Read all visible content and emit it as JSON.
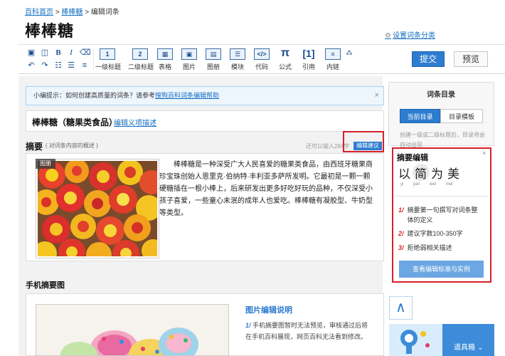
{
  "breadcrumb": {
    "home": "百科首页",
    "sep1": ">",
    "entry": "棒棒糖",
    "sep2": ">",
    "current": "编辑词条"
  },
  "page_title": "棒棒糖",
  "settings_link": "设置词条分类",
  "toolbar": {
    "buttons": [
      {
        "label": "一级标题",
        "icon": "heading-1-icon",
        "glyph": "1"
      },
      {
        "label": "二级标题",
        "icon": "heading-2-icon",
        "glyph": "2"
      },
      {
        "label": "表格",
        "icon": "table-icon",
        "glyph": "▦"
      },
      {
        "label": "图片",
        "icon": "image-icon",
        "glyph": "▣"
      },
      {
        "label": "图册",
        "icon": "album-icon",
        "glyph": "▤"
      },
      {
        "label": "模块",
        "icon": "module-icon",
        "glyph": "☰"
      },
      {
        "label": "代码",
        "icon": "code-icon",
        "glyph": "</>"
      },
      {
        "label": "公式",
        "icon": "formula-icon",
        "glyph": "π"
      },
      {
        "label": "引用",
        "icon": "reference-icon",
        "glyph": "[1]"
      },
      {
        "label": "内链",
        "icon": "link-icon",
        "glyph": "≡"
      }
    ],
    "submit": "提交",
    "preview": "预览"
  },
  "tip": {
    "prefix": "小编提示：如何创建高质量的词条？请参考",
    "link": "搜狗百科词条编辑帮助",
    "close": "×"
  },
  "entry": {
    "title": "棒棒糖（糖果类食品）",
    "edit_link": "编辑义项描述"
  },
  "summary": {
    "label": "摘要",
    "sub": "( 对词条内容的概述 )",
    "count": "还可以输入284字",
    "suggest": "编辑建议",
    "photo_tag": "图册",
    "text": "棒棒糖是一种深受广大人民喜爱的糖果类食品，由西班牙糖果商珍宝珠创始人恩里克·伯纳特·丰利亚多萨所发明。它最初是一颗一颗硬糖插在一根小棒上，后来研发出更多好吃好玩的品种，不仅深受小孩子喜爱，一些童心未泯的成年人也爱吃。棒棒糖有凝胶型、牛奶型等类型。"
  },
  "mobile": {
    "label": "手机摘要图",
    "help_title": "图片编辑说明",
    "help_num": "1/",
    "help_text": "手机摘要图暂时无法预览，审核通过后将在手机百科展现，网页百科无法看到修改。"
  },
  "toc": {
    "title": "词条目录",
    "tab_current": "当前目录",
    "tab_template": "目录模板",
    "note": "创建一级或二级标题后，目录将会自动出现"
  },
  "tip_card": {
    "title": "摘要编辑",
    "close": "×",
    "slogan": "以简为美",
    "pinyin": [
      "yi",
      "jian",
      "wei",
      "mei"
    ],
    "items": [
      {
        "n": "1/",
        "text": "摘要第一句撰写对词条整体的定义"
      },
      {
        "n": "2/",
        "text": "建议字数100-350字"
      },
      {
        "n": "3/",
        "text": "拒绝弱相关描述"
      }
    ],
    "button": "查看编辑标准与实例"
  },
  "toolbox": {
    "label": "道具箱",
    "arrow": "⌄",
    "up": "∧"
  },
  "colors": {
    "accent": "#2d7ccf",
    "highlight": "#d6202a",
    "link": "#136ec2"
  }
}
